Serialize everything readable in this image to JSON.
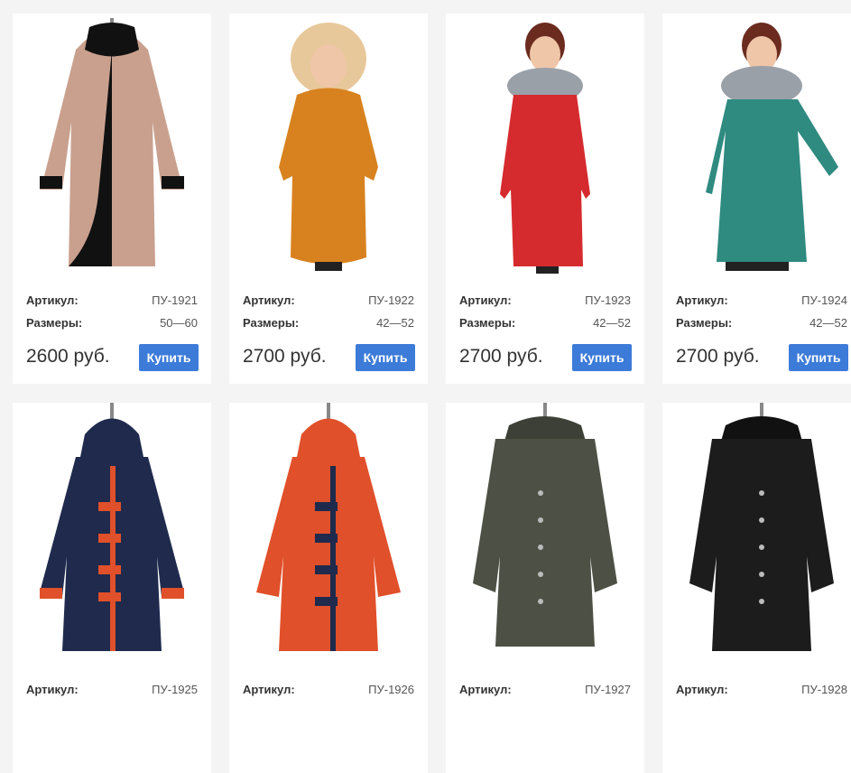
{
  "labels": {
    "article": "Артикул:",
    "sizes": "Размеры:",
    "buy": "Купить"
  },
  "products": [
    {
      "article": "ПУ-1921",
      "sizes": "50—60",
      "price": "2600 руб."
    },
    {
      "article": "ПУ-1922",
      "sizes": "42—52",
      "price": "2700 руб."
    },
    {
      "article": "ПУ-1923",
      "sizes": "42—52",
      "price": "2700 руб."
    },
    {
      "article": "ПУ-1924",
      "sizes": "42—52",
      "price": "2700 руб."
    },
    {
      "article": "ПУ-1925",
      "sizes": "",
      "price": ""
    },
    {
      "article": "ПУ-1926",
      "sizes": "",
      "price": ""
    },
    {
      "article": "ПУ-1927",
      "sizes": "",
      "price": ""
    },
    {
      "article": "ПУ-1928",
      "sizes": "",
      "price": ""
    }
  ],
  "colors": {
    "accent": "#3c7bd8",
    "coats": [
      "#c9a08e",
      "#d8821f",
      "#d52b2f",
      "#2f8a80",
      "#1f2a4d",
      "#e0502a",
      "#4d5044",
      "#1c1c1c"
    ]
  }
}
